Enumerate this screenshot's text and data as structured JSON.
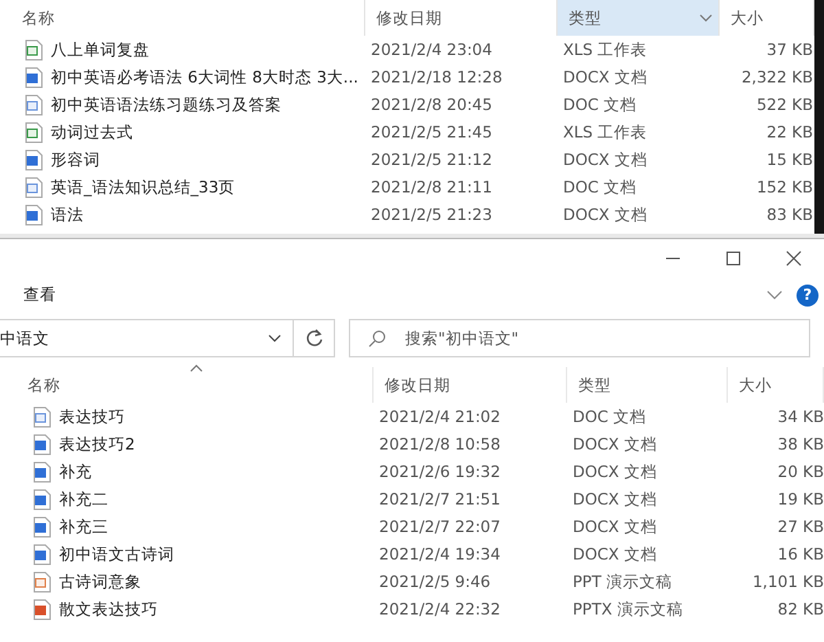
{
  "back_window": {
    "columns": [
      {
        "label": "名称",
        "selected": false
      },
      {
        "label": "修改日期",
        "selected": false
      },
      {
        "label": "类型",
        "selected": true
      },
      {
        "label": "大小",
        "selected": false
      }
    ],
    "files": [
      {
        "name": "八上单词复盘",
        "modified": "2021/2/4 23:04",
        "type": "XLS 工作表",
        "size": "37 KB",
        "kind": "xls"
      },
      {
        "name": "初中英语必考语法 6大词性 8大时态 3大...",
        "modified": "2021/2/18 12:28",
        "type": "DOCX 文档",
        "size": "2,322 KB",
        "kind": "docx"
      },
      {
        "name": "初中英语语法练习题练习及答案",
        "modified": "2021/2/8 20:45",
        "type": "DOC 文档",
        "size": "522 KB",
        "kind": "doc"
      },
      {
        "name": "动词过去式",
        "modified": "2021/2/5 21:45",
        "type": "XLS 工作表",
        "size": "22 KB",
        "kind": "xls"
      },
      {
        "name": "形容词",
        "modified": "2021/2/5 21:12",
        "type": "DOCX 文档",
        "size": "15 KB",
        "kind": "docx"
      },
      {
        "name": "英语_语法知识总结_33页",
        "modified": "2021/2/8 21:11",
        "type": "DOC 文档",
        "size": "152 KB",
        "kind": "doc"
      },
      {
        "name": "语法",
        "modified": "2021/2/5 21:23",
        "type": "DOCX 文档",
        "size": "83 KB",
        "kind": "docx"
      }
    ]
  },
  "front_window": {
    "ribbon_tab": "查看",
    "help": "?",
    "address": "中语文",
    "search": {
      "placeholder": "搜索\"初中语文\""
    },
    "columns": [
      {
        "label": "名称",
        "sorted": true
      },
      {
        "label": "修改日期",
        "sorted": false
      },
      {
        "label": "类型",
        "sorted": false
      },
      {
        "label": "大小",
        "sorted": false
      }
    ],
    "files": [
      {
        "name": "表达技巧",
        "modified": "2021/2/4 21:02",
        "type": "DOC 文档",
        "size": "34 KB",
        "kind": "doc"
      },
      {
        "name": "表达技巧2",
        "modified": "2021/2/8 10:58",
        "type": "DOCX 文档",
        "size": "38 KB",
        "kind": "docx"
      },
      {
        "name": "补充",
        "modified": "2021/2/6 19:32",
        "type": "DOCX 文档",
        "size": "20 KB",
        "kind": "docx"
      },
      {
        "name": "补充二",
        "modified": "2021/2/7 21:51",
        "type": "DOCX 文档",
        "size": "19 KB",
        "kind": "docx"
      },
      {
        "name": "补充三",
        "modified": "2021/2/7 22:07",
        "type": "DOCX 文档",
        "size": "27 KB",
        "kind": "docx"
      },
      {
        "name": "初中语文古诗词",
        "modified": "2021/2/4 19:34",
        "type": "DOCX 文档",
        "size": "16 KB",
        "kind": "docx"
      },
      {
        "name": "古诗词意象",
        "modified": "2021/2/5 9:46",
        "type": "PPT 演示文稿",
        "size": "1,101 KB",
        "kind": "ppt"
      },
      {
        "name": "散文表达技巧",
        "modified": "2021/2/4 22:32",
        "type": "PPTX 演示文稿",
        "size": "82 KB",
        "kind": "pptx"
      }
    ]
  }
}
